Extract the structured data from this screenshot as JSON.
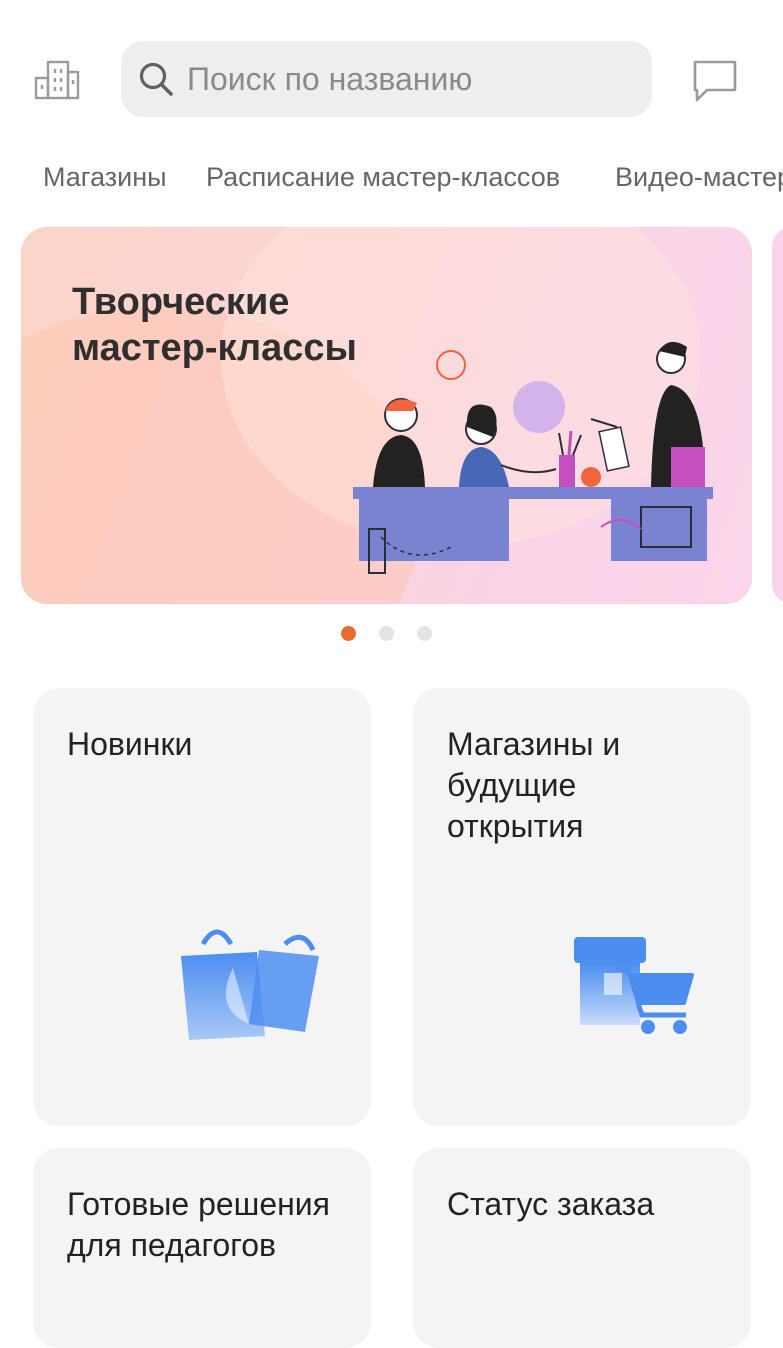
{
  "header": {
    "city_icon": "city-building-icon",
    "search_placeholder": "Поиск по названию",
    "search_icon": "search-icon",
    "chat_icon": "chat-icon"
  },
  "tabs": [
    {
      "label": "Магазины"
    },
    {
      "label": "Расписание мастер-классов"
    },
    {
      "label": "Видео-мастер-классы"
    }
  ],
  "banner": {
    "title": "Творческие мастер-классы",
    "illustration": "people-crafting-illustration",
    "slide_count": 3,
    "active_slide": 1
  },
  "cards": [
    {
      "title": "Новинки",
      "icon": "shopping-bags-icon"
    },
    {
      "title": "Магазины и\nбудущие\nоткрытия",
      "icon": "store-cart-icon"
    },
    {
      "title": "Готовые решения\nдля педагогов",
      "icon": ""
    },
    {
      "title": "Статус заказа",
      "icon": ""
    }
  ],
  "colors": {
    "accent": "#e86d2d",
    "icon_blue": "#4c8ef0",
    "card_bg": "#f4f4f5",
    "search_bg": "#eeeeef"
  }
}
